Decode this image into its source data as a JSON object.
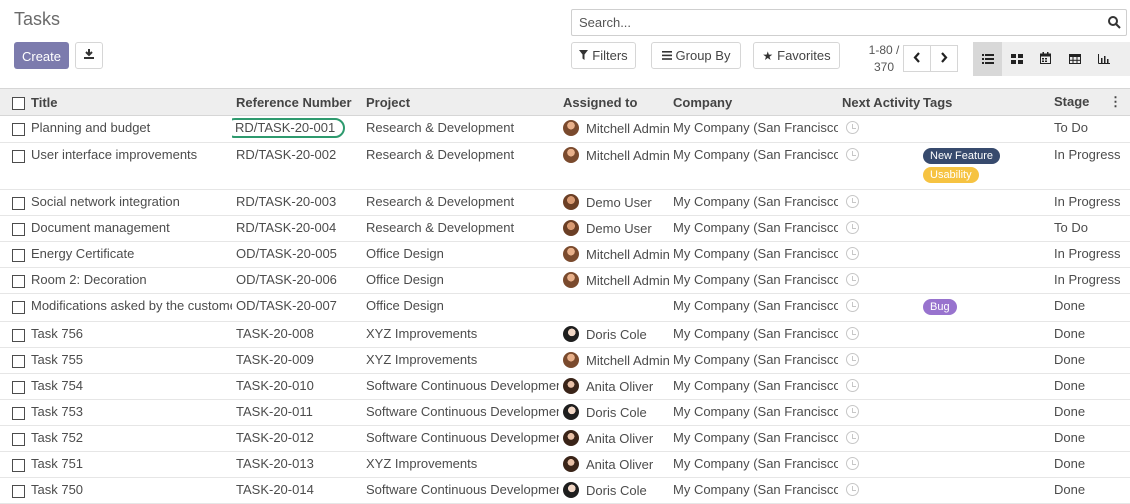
{
  "page": {
    "title": "Tasks"
  },
  "toolbar": {
    "create_label": "Create"
  },
  "search": {
    "placeholder": "Search..."
  },
  "filters": {
    "filters_label": "Filters",
    "group_by_label": "Group By",
    "favorites_label": "Favorites"
  },
  "pager": {
    "range": "1-80 /",
    "total": "370"
  },
  "columns": [
    "Title",
    "Reference Number",
    "Project",
    "Assigned to",
    "Company",
    "Next Activity",
    "Tags",
    "Stage"
  ],
  "colors": {
    "primary": "#7c7bad",
    "tag_new_feature": "#374a6d",
    "tag_usability": "#f6c342",
    "tag_bug": "#9873ce",
    "highlight": "#2e9a6e"
  },
  "rows": [
    {
      "title": "Planning and budget",
      "ref": "RD/TASK-20-001",
      "project": "Research & Development",
      "assignee": "Mitchell Admin",
      "avatar": "admin",
      "company": "My Company (San Francisco)",
      "tags": [],
      "stage": "To Do",
      "highlight_ref": true
    },
    {
      "title": "User interface improvements",
      "ref": "RD/TASK-20-002",
      "project": "Research & Development",
      "assignee": "Mitchell Admin",
      "avatar": "admin",
      "company": "My Company (San Francisco)",
      "tags": [
        {
          "label": "New Feature",
          "color": "#374a6d"
        },
        {
          "label": "Usability",
          "color": "#f6c342"
        }
      ],
      "stage": "In Progress"
    },
    {
      "title": "Social network integration",
      "ref": "RD/TASK-20-003",
      "project": "Research & Development",
      "assignee": "Demo User",
      "avatar": "demo",
      "company": "My Company (San Francisco)",
      "tags": [],
      "stage": "In Progress"
    },
    {
      "title": "Document management",
      "ref": "RD/TASK-20-004",
      "project": "Research & Development",
      "assignee": "Demo User",
      "avatar": "demo",
      "company": "My Company (San Francisco)",
      "tags": [],
      "stage": "To Do"
    },
    {
      "title": "Energy Certificate",
      "ref": "OD/TASK-20-005",
      "project": "Office Design",
      "assignee": "Mitchell Admin",
      "avatar": "admin",
      "company": "My Company (San Francisco)",
      "tags": [],
      "stage": "In Progress"
    },
    {
      "title": "Room 2: Decoration",
      "ref": "OD/TASK-20-006",
      "project": "Office Design",
      "assignee": "Mitchell Admin",
      "avatar": "admin",
      "company": "My Company (San Francisco)",
      "tags": [],
      "stage": "In Progress"
    },
    {
      "title": "Modifications asked by the customer",
      "ref": "OD/TASK-20-007",
      "project": "Office Design",
      "assignee": "",
      "avatar": "",
      "company": "My Company (San Francisco)",
      "tags": [
        {
          "label": "Bug",
          "color": "#9873ce"
        }
      ],
      "stage": "Done"
    },
    {
      "title": "Task 756",
      "ref": "TASK-20-008",
      "project": "XYZ Improvements",
      "assignee": "Doris Cole",
      "avatar": "doris",
      "company": "My Company (San Francisco)",
      "tags": [],
      "stage": "Done"
    },
    {
      "title": "Task 755",
      "ref": "TASK-20-009",
      "project": "XYZ Improvements",
      "assignee": "Mitchell Admin",
      "avatar": "admin",
      "company": "My Company (San Francisco)",
      "tags": [],
      "stage": "Done"
    },
    {
      "title": "Task 754",
      "ref": "TASK-20-010",
      "project": "Software Continuous Development",
      "assignee": "Anita Oliver",
      "avatar": "anita",
      "company": "My Company (San Francisco)",
      "tags": [],
      "stage": "Done"
    },
    {
      "title": "Task 753",
      "ref": "TASK-20-011",
      "project": "Software Continuous Development",
      "assignee": "Doris Cole",
      "avatar": "doris",
      "company": "My Company (San Francisco)",
      "tags": [],
      "stage": "Done"
    },
    {
      "title": "Task 752",
      "ref": "TASK-20-012",
      "project": "Software Continuous Development",
      "assignee": "Anita Oliver",
      "avatar": "anita",
      "company": "My Company (San Francisco)",
      "tags": [],
      "stage": "Done"
    },
    {
      "title": "Task 751",
      "ref": "TASK-20-013",
      "project": "XYZ Improvements",
      "assignee": "Anita Oliver",
      "avatar": "anita",
      "company": "My Company (San Francisco)",
      "tags": [],
      "stage": "Done"
    },
    {
      "title": "Task 750",
      "ref": "TASK-20-014",
      "project": "Software Continuous Development",
      "assignee": "Doris Cole",
      "avatar": "doris",
      "company": "My Company (San Francisco)",
      "tags": [],
      "stage": "Done"
    }
  ]
}
